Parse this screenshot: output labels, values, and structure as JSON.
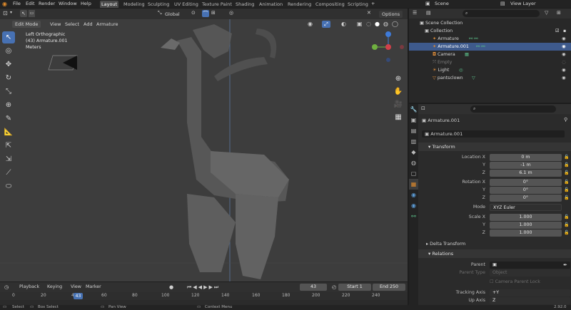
{
  "menu": [
    "File",
    "Edit",
    "Render",
    "Window",
    "Help"
  ],
  "workspaces": [
    "Layout",
    "Modeling",
    "Sculpting",
    "UV Editing",
    "Texture Paint",
    "Shading",
    "Animation",
    "Rendering",
    "Compositing",
    "Scripting"
  ],
  "add_workspace": "+",
  "scene": {
    "label": "Scene",
    "view_layer": "View Layer"
  },
  "viewport": {
    "mode": "Edit Mode",
    "menus": [
      "View",
      "Select",
      "Add",
      "Armature"
    ],
    "pivot": "Global",
    "options": "Options",
    "overlay_lines": [
      "Left Orthographic",
      "(43) Armature.001",
      "Meters"
    ]
  },
  "timeline": {
    "menus": [
      "Playback",
      "Keying",
      "View",
      "Marker"
    ],
    "current_frame": "43",
    "start_label": "Start",
    "start": "1",
    "end_label": "End",
    "end": "250",
    "ticks": [
      "0",
      "20",
      "40",
      "60",
      "80",
      "100",
      "120",
      "140",
      "160",
      "180",
      "200",
      "220",
      "240"
    ],
    "playhead": "43"
  },
  "status": {
    "select": "Select",
    "box_select": "Box Select",
    "pan": "Pan View",
    "context": "Context Menu",
    "version": "2.92.0"
  },
  "outliner": {
    "rows": [
      {
        "label": "Scene Collection",
        "selected": false
      },
      {
        "label": "Collection",
        "selected": false
      },
      {
        "label": "Armature",
        "selected": false
      },
      {
        "label": "Armature.001",
        "selected": true
      },
      {
        "label": "Camera",
        "selected": false
      },
      {
        "label": "Empty",
        "selected": false
      },
      {
        "label": "Light",
        "selected": false
      },
      {
        "label": "pantsclown",
        "selected": false
      }
    ]
  },
  "properties": {
    "object_name": "Armature.001",
    "datablock": "Armature.001",
    "transform_header": "Transform",
    "location_label": "Location X",
    "loc": [
      "0 m",
      "-1 m",
      "6.1 m"
    ],
    "rotation_label": "Rotation X",
    "rot": [
      "0°",
      "0°",
      "0°"
    ],
    "mode_label": "Mode",
    "mode": "XYZ Euler",
    "scale_label": "Scale X",
    "scale": [
      "1.000",
      "1.000",
      "1.000"
    ],
    "axis_y": "Y",
    "axis_z": "Z",
    "delta": "Delta Transform",
    "relations": "Relations",
    "parent": "Parent",
    "parent_type": "Parent Type",
    "parent_type_val": "Object",
    "camera_lock": "Camera Parent Lock",
    "tracking_axis": "Tracking Axis",
    "tracking_val": "+Y",
    "up_axis": "Up Axis",
    "up_val": "Z"
  },
  "colors": {
    "accent": "#4772b3",
    "selection": "#3e5a8c",
    "viewport_bg": "#3d3d3d"
  }
}
